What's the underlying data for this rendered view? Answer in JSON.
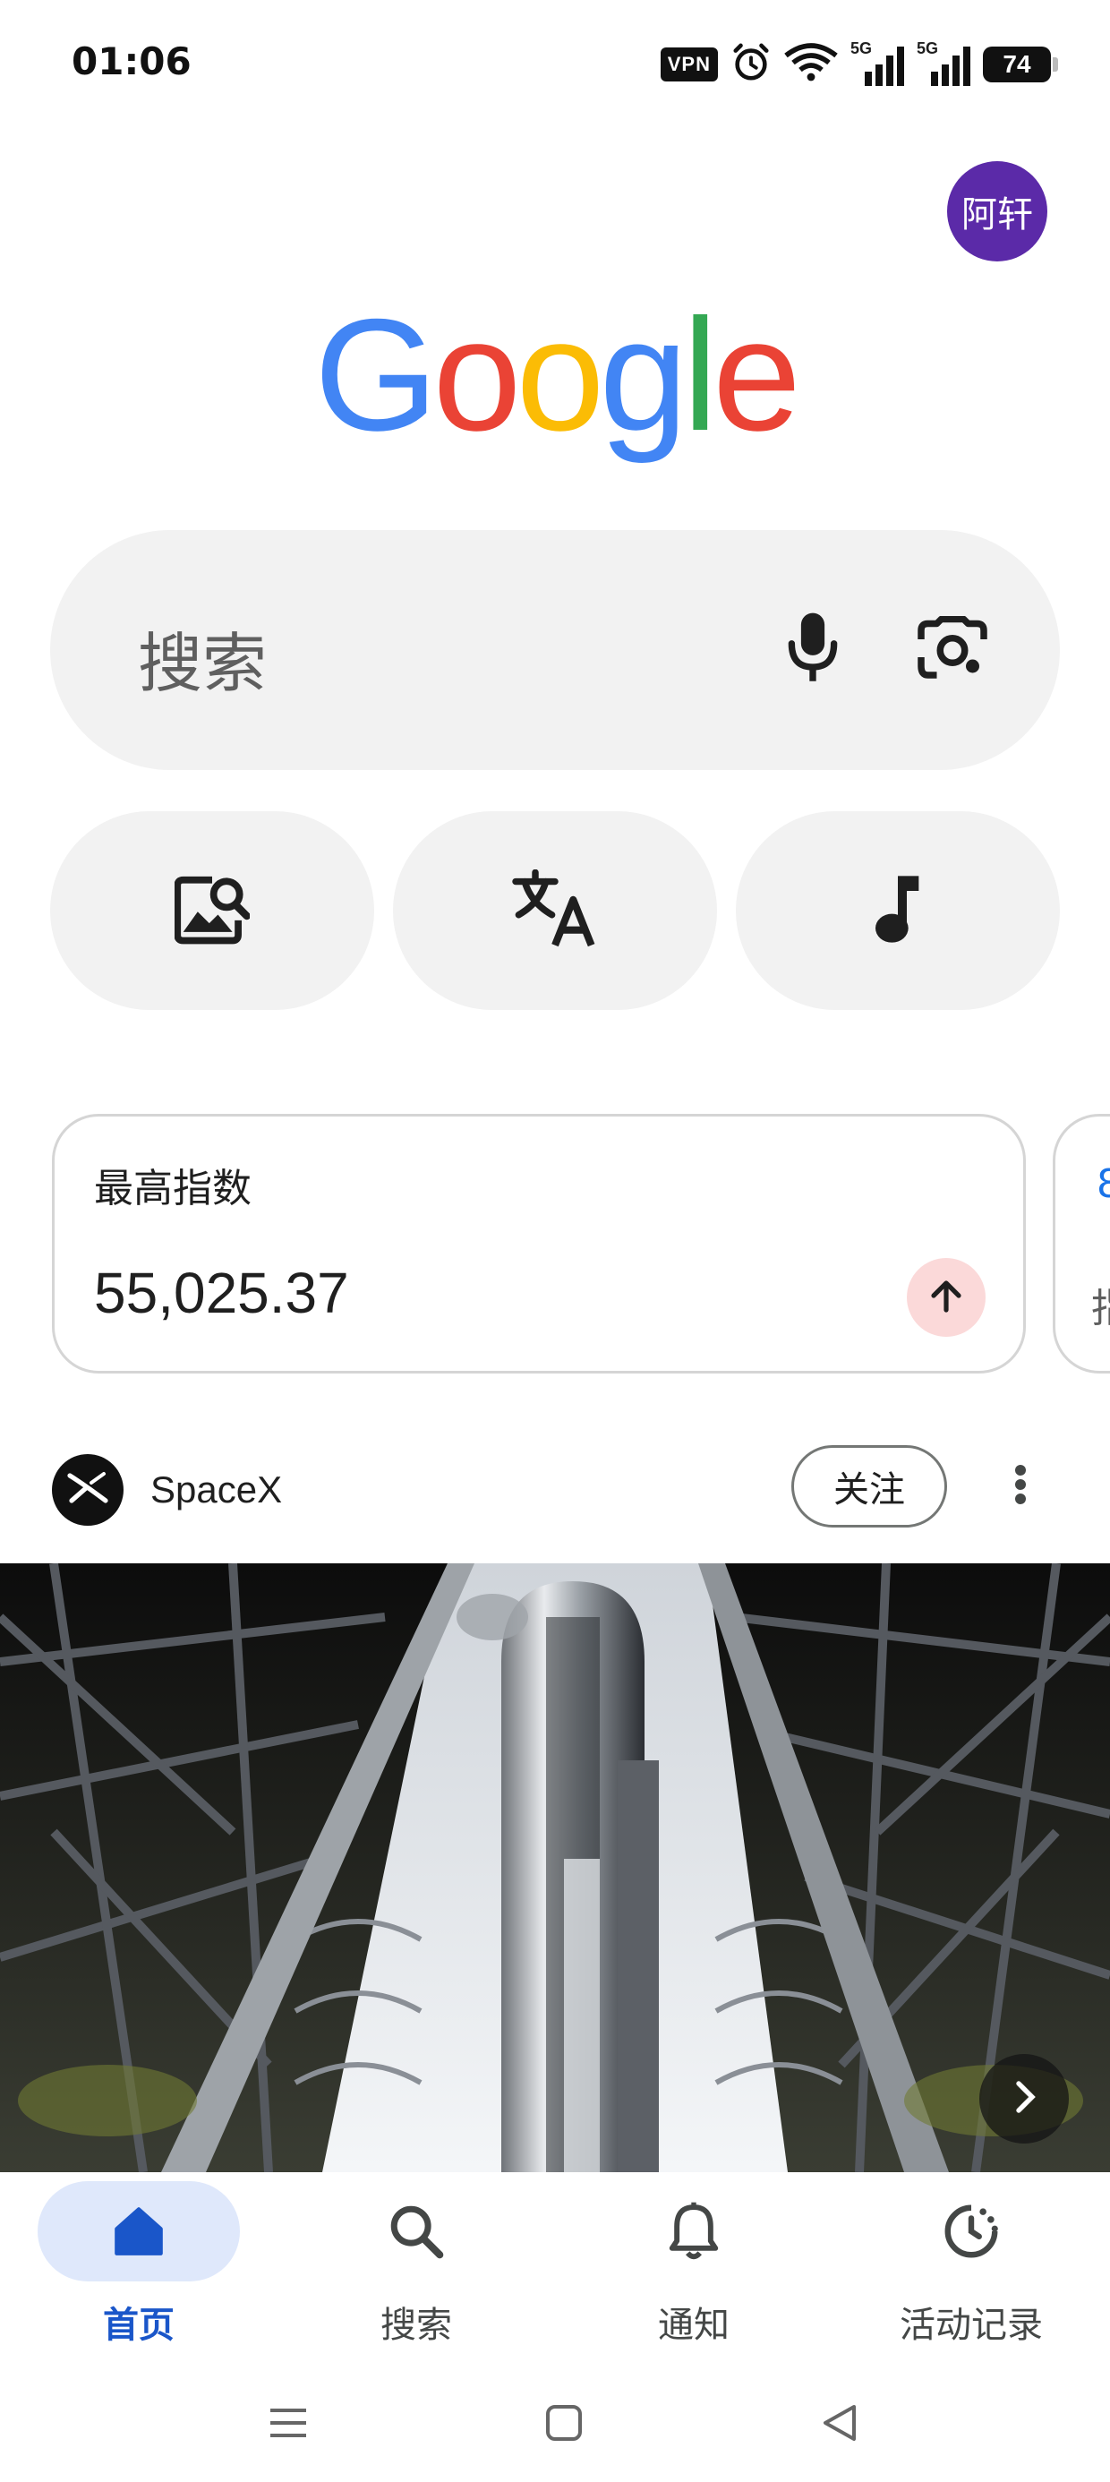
{
  "status_bar": {
    "time": "01:06",
    "vpn_label": "VPN",
    "network_1": "5G",
    "network_2": "5G",
    "battery": "74"
  },
  "account": {
    "avatar_text": "阿轩",
    "avatar_color": "#5b2aa8"
  },
  "logo": {
    "letters": [
      {
        "char": "G",
        "color": "#4285F4"
      },
      {
        "char": "o",
        "color": "#EA4335"
      },
      {
        "char": "o",
        "color": "#FBBC05"
      },
      {
        "char": "g",
        "color": "#4285F4"
      },
      {
        "char": "l",
        "color": "#34A853"
      },
      {
        "char": "e",
        "color": "#EA4335"
      }
    ]
  },
  "search": {
    "placeholder": "搜索",
    "mic_icon": "mic-icon",
    "lens_icon": "camera-lens-icon"
  },
  "quick_actions": [
    {
      "icon": "image-search-icon"
    },
    {
      "icon": "translate-icon"
    },
    {
      "icon": "music-note-icon"
    }
  ],
  "stock_card": {
    "label": "最高指数",
    "value": "55,025.37",
    "trend": "up",
    "trend_color": "#fbd9d9"
  },
  "next_card": {
    "fragment_top": "8",
    "fragment_bottom": "指"
  },
  "feed": {
    "source_name": "SpaceX",
    "follow_label": "关注",
    "more_icon": "more-vert-icon"
  },
  "bottom_nav": {
    "items": [
      {
        "label": "首页",
        "icon": "home-icon",
        "active": true
      },
      {
        "label": "搜索",
        "icon": "search-icon",
        "active": false
      },
      {
        "label": "通知",
        "icon": "bell-icon",
        "active": false
      },
      {
        "label": "活动记录",
        "icon": "activity-history-icon",
        "active": false
      }
    ],
    "accent": "#1a56c9"
  },
  "system_nav": [
    "menu-icon",
    "home-square-icon",
    "back-triangle-icon"
  ]
}
